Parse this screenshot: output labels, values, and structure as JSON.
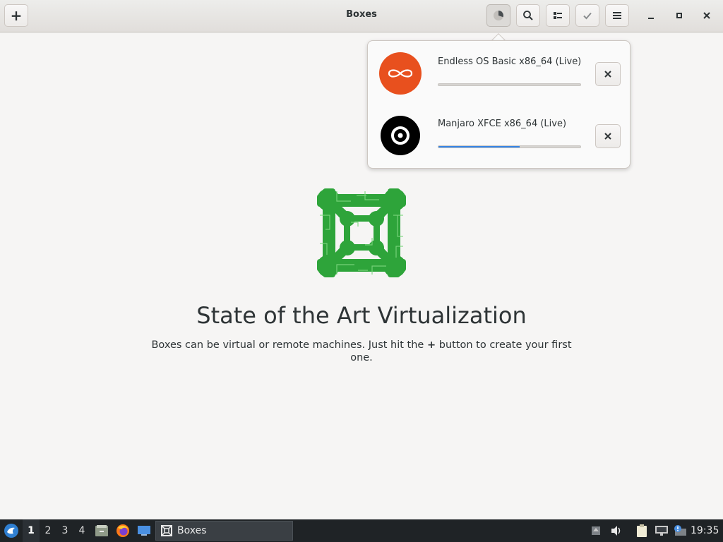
{
  "window": {
    "title": "Boxes",
    "new_button": "+"
  },
  "header_buttons": [
    "downloads-icon",
    "search-icon",
    "view-toggle-icon",
    "select-icon",
    "menu-icon"
  ],
  "window_controls": [
    "minimize-icon",
    "maximize-icon",
    "close-icon"
  ],
  "downloads": [
    {
      "name": "Endless OS Basic x86_64 (Live)",
      "progress": 0.0,
      "icon": "endless-os-icon",
      "icon_color": "#e8501e"
    },
    {
      "name": "Manjaro XFCE x86_64 (Live)",
      "progress": 0.57,
      "icon": "disc-icon",
      "icon_color": "#000000"
    }
  ],
  "empty_state": {
    "title": "State of the Art Virtualization",
    "desc_before": "Boxes can be virtual or remote machines. Just hit the",
    "desc_plus": "+",
    "desc_after": "button to create your first one."
  },
  "taskbar": {
    "workspaces": [
      "1",
      "2",
      "3",
      "4"
    ],
    "active_workspace": "1",
    "task_label": "Boxes",
    "clock": "19:35"
  },
  "colors": {
    "accent": "#3584e4",
    "logo_green": "#2ea43a",
    "endless_orange": "#e8501e"
  }
}
